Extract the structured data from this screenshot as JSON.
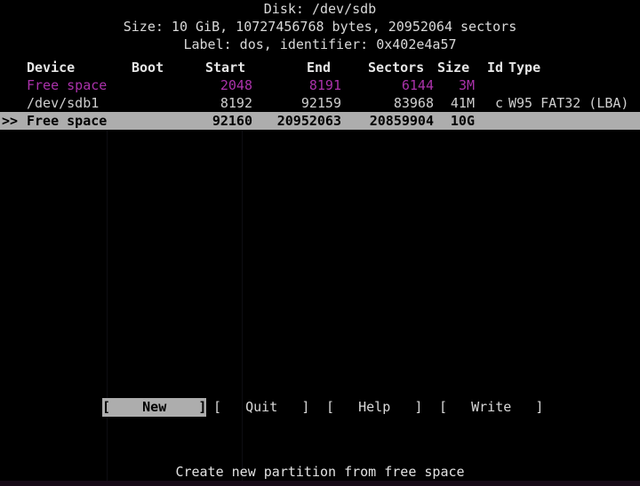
{
  "app": {
    "name": "cfdisk",
    "colors": {
      "background": "#000000",
      "foreground": "#d9d9d9",
      "free_space": "#ab32ab",
      "selection_bg": "#adadad",
      "selection_fg": "#000000"
    }
  },
  "disk_info": {
    "line1": "Disk: /dev/sdb",
    "line2": "Size: 10 GiB, 10727456768 bytes, 20952064 sectors",
    "line3": "Label: dos, identifier: 0x402e4a57",
    "device": "/dev/sdb",
    "size_human": "10 GiB",
    "size_bytes": "10727456768",
    "sectors_total": "20952064",
    "label_type": "dos",
    "identifier": "0x402e4a57"
  },
  "table": {
    "headers": {
      "device": "Device",
      "boot": "Boot",
      "start": "Start",
      "end": "End",
      "sectors": "Sectors",
      "size": "Size",
      "id": "Id",
      "type": "Type"
    },
    "rows": [
      {
        "marker": "",
        "device": "Free space",
        "boot": "",
        "start": "2048",
        "end": "8191",
        "sectors": "6144",
        "size": "3M",
        "id": "",
        "type": "",
        "style": "free",
        "selected": false
      },
      {
        "marker": "",
        "device": "/dev/sdb1",
        "boot": "",
        "start": "8192",
        "end": "92159",
        "sectors": "83968",
        "size": "41M",
        "id": "c",
        "type": "W95 FAT32 (LBA)",
        "style": "partition",
        "selected": false
      },
      {
        "marker": ">>",
        "device": "Free space",
        "boot": "",
        "start": "92160",
        "end": "20952063",
        "sectors": "20859904",
        "size": "10G",
        "id": "",
        "type": "",
        "style": "free",
        "selected": true
      }
    ]
  },
  "menu": {
    "buttons": [
      {
        "label": "[    New    ]",
        "name": "New",
        "selected": true
      },
      {
        "label": "[   Quit   ]",
        "name": "Quit",
        "selected": false
      },
      {
        "label": "[   Help   ]",
        "name": "Help",
        "selected": false
      },
      {
        "label": "[   Write   ]",
        "name": "Write",
        "selected": false
      }
    ]
  },
  "status": {
    "hint": "Create new partition from free space"
  }
}
